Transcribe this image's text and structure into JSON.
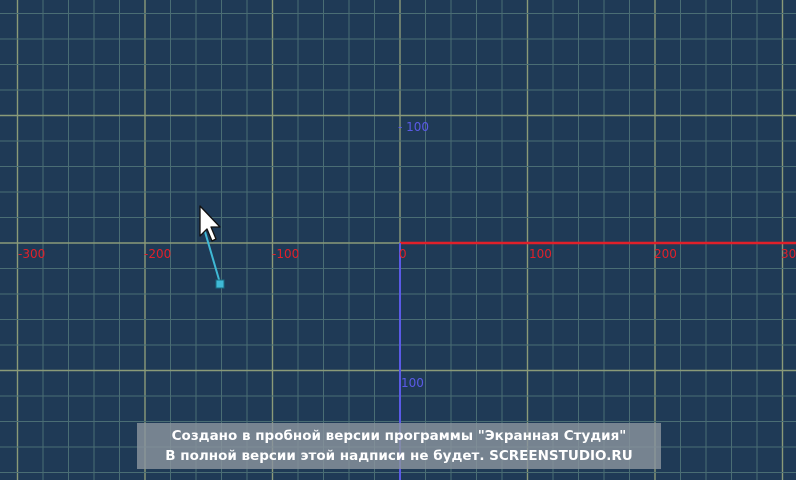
{
  "canvas": {
    "background": "#1f3a56",
    "grid_minor_color": "#4a6d74",
    "grid_major_color": "#8a9a78",
    "x_axis_color": "#e0202a",
    "y_axis_color": "#5a5ae6"
  },
  "x_axis": {
    "tick_labels": [
      "-300",
      "-200",
      "-100",
      "0",
      "100",
      "200",
      "30"
    ]
  },
  "y_axis": {
    "tick_labels": [
      "- 100",
      "100"
    ]
  },
  "cursor": {
    "icon": "arrow-pointer-icon",
    "handle_icon": "square-handle-icon",
    "line_color": "#3fb9d6"
  },
  "watermark": {
    "line1": "Создано в пробной версии программы \"Экранная Студия\"",
    "line2": "В полной версии этой надписи не будет. SCREENSTUDIO.RU"
  }
}
